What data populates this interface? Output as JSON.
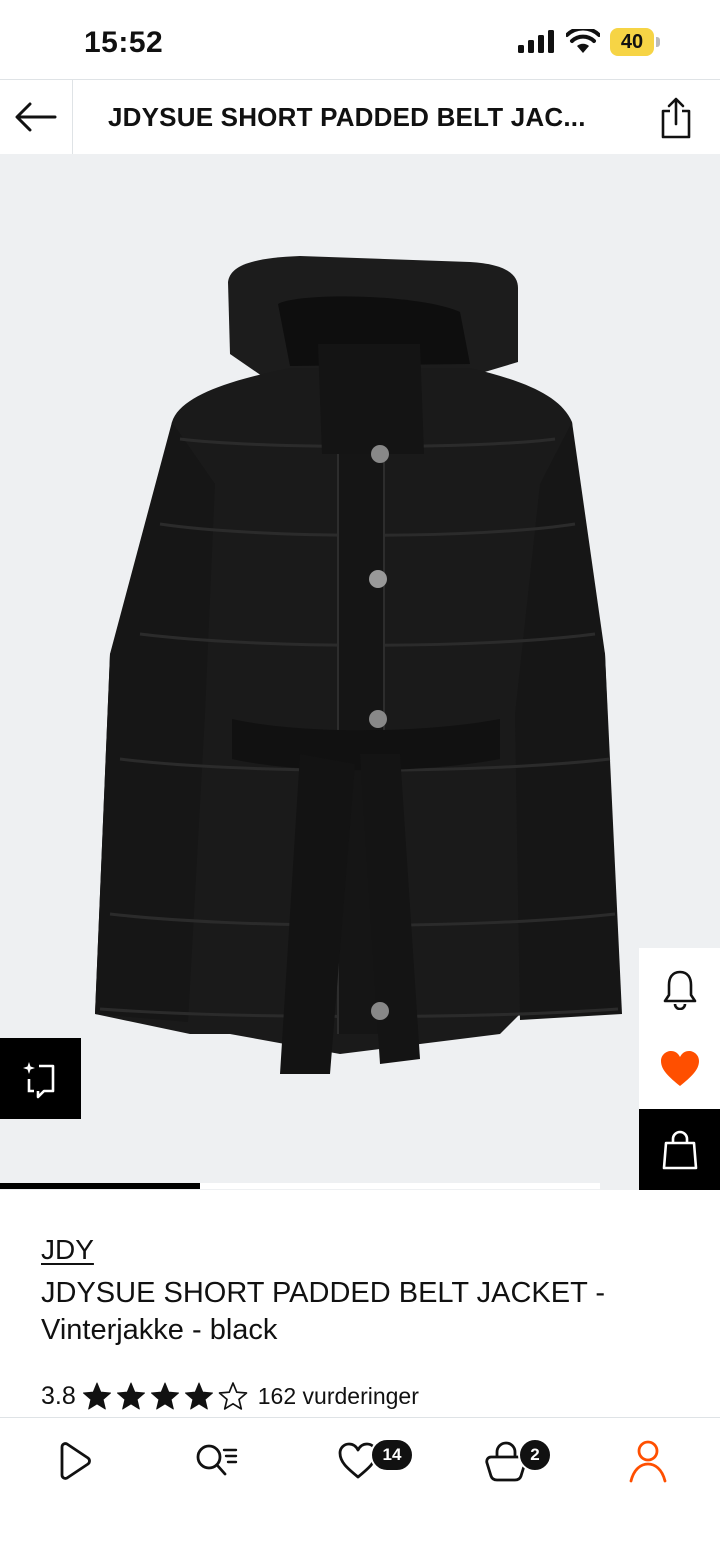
{
  "status_bar": {
    "time": "15:52",
    "battery": "40"
  },
  "header": {
    "title": "JDYSUE SHORT PADDED BELT JAC..."
  },
  "gallery": {
    "progress": 0.333
  },
  "product": {
    "brand": "JDY",
    "name": "JDYSUE SHORT PADDED BELT JACKET - Vinterjakke - black",
    "rating": "3.8",
    "stars_filled": 4,
    "stars_total": 5,
    "rating_count": "162 vurderinger"
  },
  "nav": {
    "wishlist_badge": "14",
    "bag_badge": "2"
  },
  "colors": {
    "accent": "#ff4f00",
    "black": "#000000",
    "image_bg": "#eef0f2"
  }
}
